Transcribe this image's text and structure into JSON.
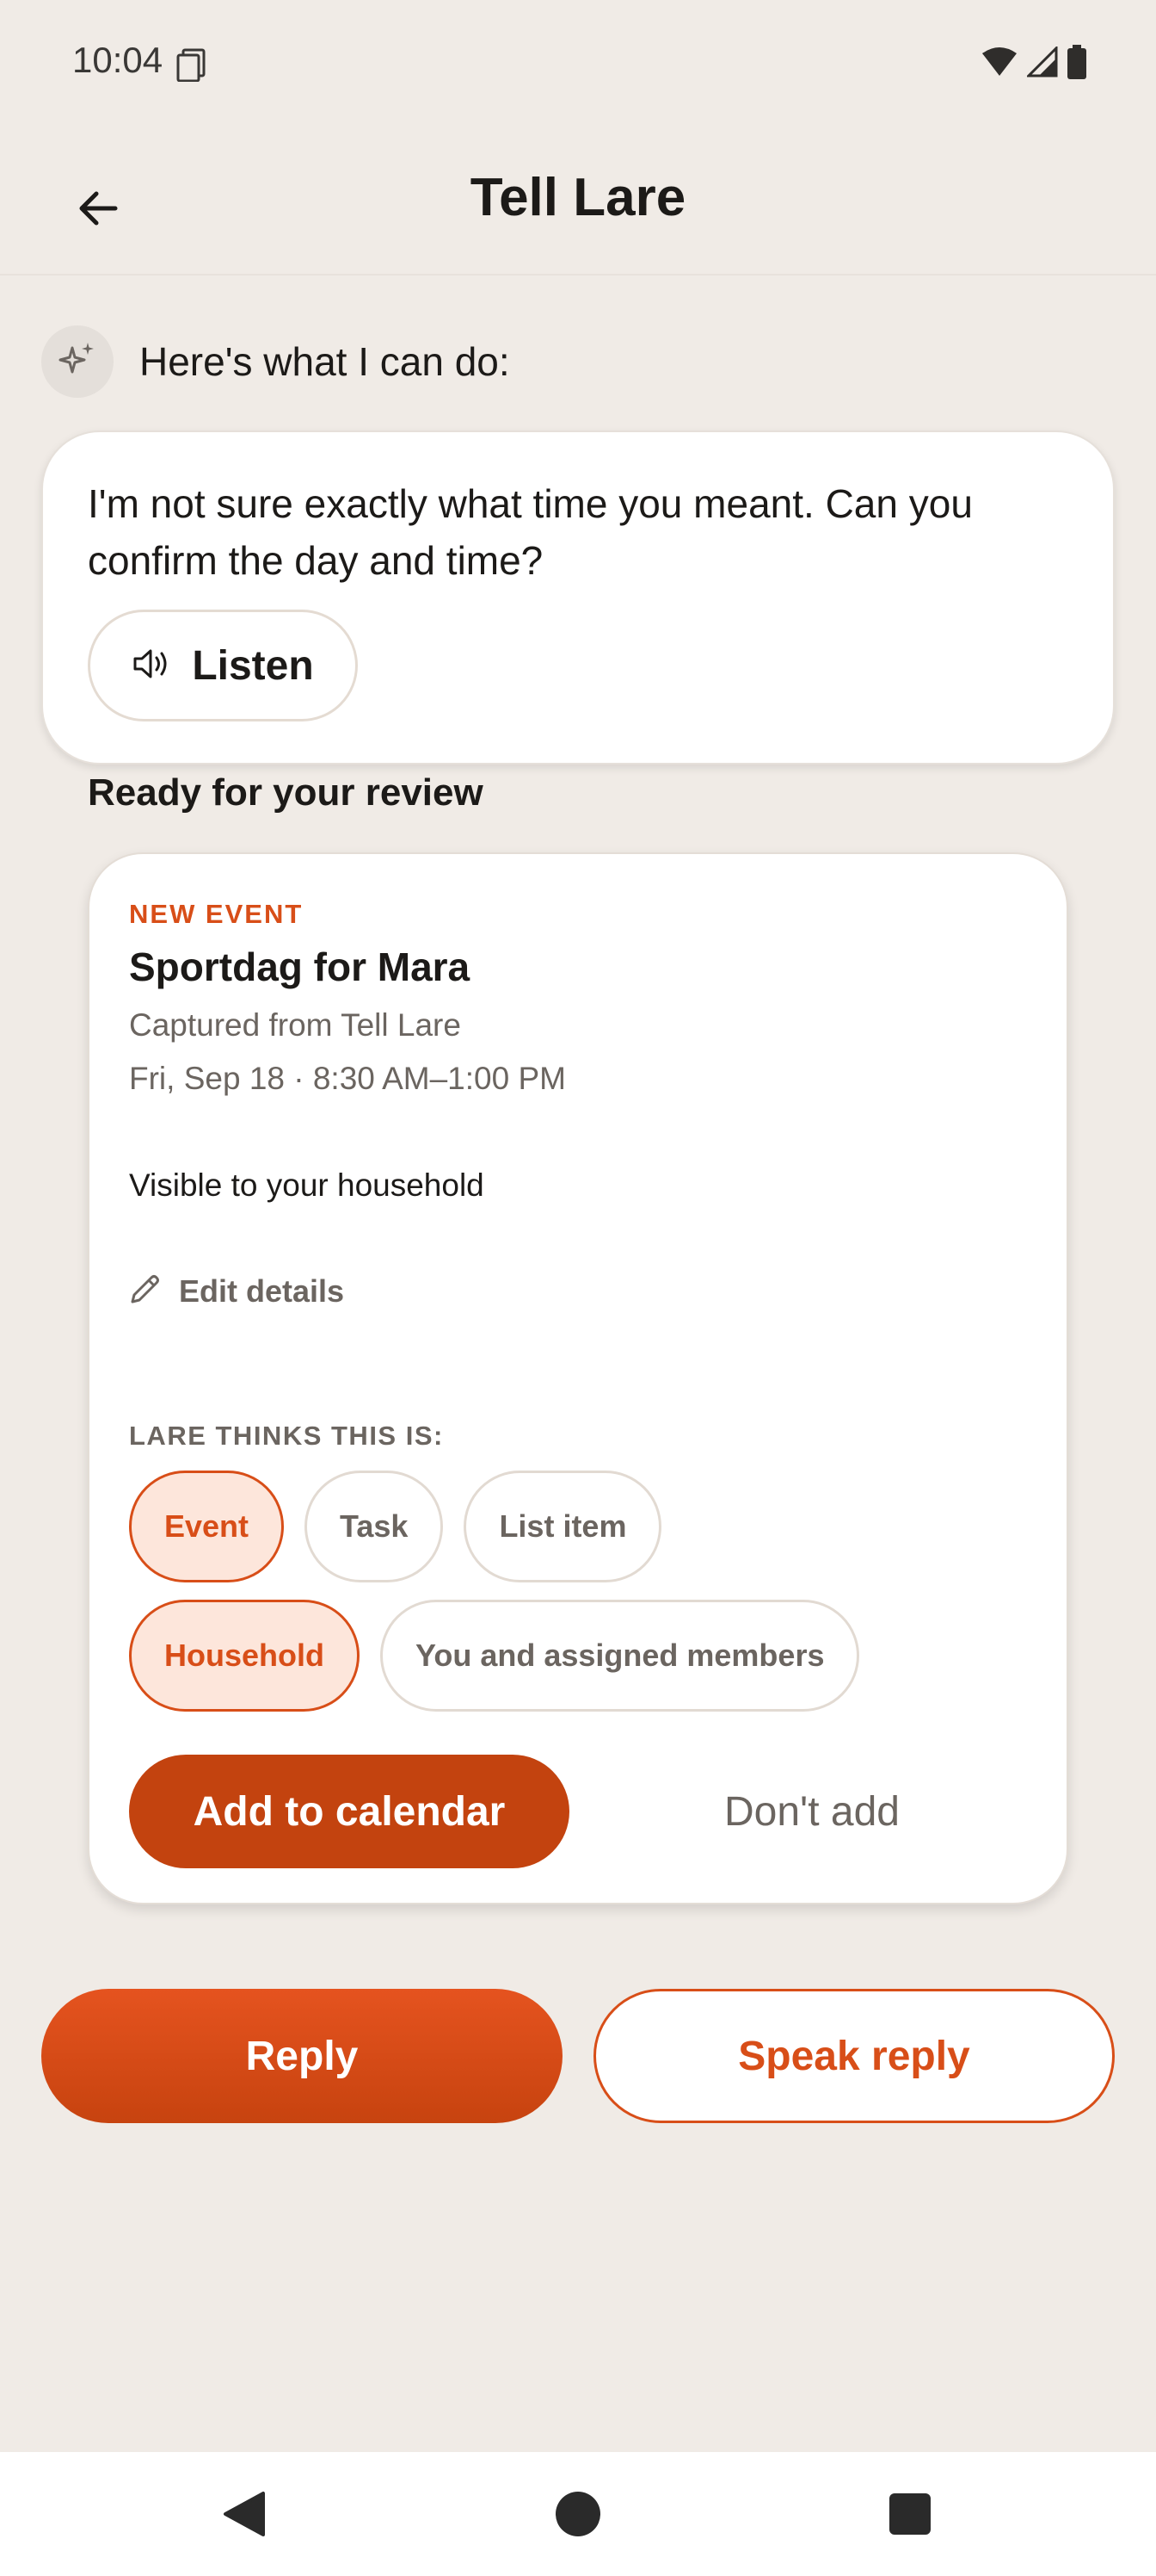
{
  "status_bar": {
    "time": "10:04",
    "icons": [
      "sim-card-icon",
      "wifi-icon",
      "signal-icon",
      "battery-icon"
    ]
  },
  "app_bar": {
    "title": "Tell Lare",
    "back_icon": "arrow-left-icon"
  },
  "assistant": {
    "avatar_icon": "sparkle-icon",
    "intro": "Here's what I can do:",
    "message": "I'm not sure exactly what time you meant. Can you confirm the day and time?",
    "listen_label": "Listen",
    "listen_icon": "speaker-icon"
  },
  "review": {
    "heading": "Ready for your review",
    "card": {
      "kicker": "NEW EVENT",
      "title": "Sportdag for Mara",
      "source": "Captured from Tell Lare",
      "when": "Fri, Sep 18 · 8:30 AM–1:00 PM",
      "visibility": "Visible to your household",
      "edit_label": "Edit details",
      "classify_label": "LARE THINKS THIS IS:",
      "type_chips": [
        {
          "label": "Event",
          "selected": true
        },
        {
          "label": "Task",
          "selected": false
        },
        {
          "label": "List item",
          "selected": false
        }
      ],
      "audience_chips": [
        {
          "label": "Household",
          "selected": true
        },
        {
          "label": "You and assigned members",
          "selected": false
        }
      ],
      "primary_action": "Add to calendar",
      "secondary_action": "Don't add"
    }
  },
  "actions": {
    "reply": "Reply",
    "speak_reply": "Speak reply"
  },
  "colors": {
    "background": "#f0ebe6",
    "accent": "#d84e18",
    "accent_dark": "#c3430f",
    "chip_selected_bg": "#fde6db",
    "muted_text": "#6b6560"
  }
}
